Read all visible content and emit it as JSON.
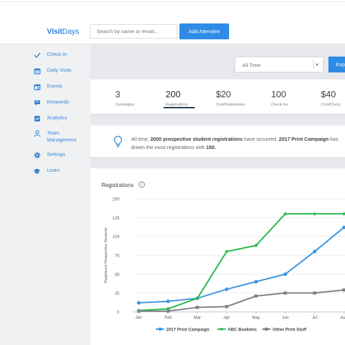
{
  "header": {
    "logo_visit": "Visit",
    "logo_days": "Days",
    "search_placeholder": "Search by name or email...",
    "add_button": "Add Attendee"
  },
  "sidebar": {
    "items": [
      {
        "label": "Check In",
        "icon": "check-icon"
      },
      {
        "label": "Daily Visits",
        "icon": "calendar-icon"
      },
      {
        "label": "Events",
        "icon": "calendar-event-icon"
      },
      {
        "label": "Keywords",
        "icon": "chat-icon"
      },
      {
        "label": "Analytics",
        "icon": "chart-icon"
      },
      {
        "label": "Team Management",
        "icon": "person-icon"
      },
      {
        "label": "Settings",
        "icon": "gear-icon"
      },
      {
        "label": "Learn",
        "icon": "graduation-cap-icon"
      }
    ]
  },
  "filters": {
    "time_range": "All Time",
    "export_label": "Exp"
  },
  "stats": [
    {
      "value": "3",
      "caption": "Campaigns"
    },
    {
      "value": "200",
      "caption": "Registrations"
    },
    {
      "value": "$20",
      "caption": "Cost/Registration"
    },
    {
      "value": "100",
      "caption": "Check Ins"
    },
    {
      "value": "$40",
      "caption": "Cost/Check"
    }
  ],
  "insight": {
    "p1": "All time, ",
    "b1": "2000 prospective student registrations",
    "p2": " have occurred. ",
    "b2": "2017 Print Campaign",
    "p3": " has driven the most registrations with ",
    "b3": "150."
  },
  "chart": {
    "title": "Registrations"
  },
  "chart_data": {
    "type": "line",
    "ylabel": "Registered Prospective Students",
    "xlabel": "",
    "ylim": [
      0,
      150
    ],
    "yticks": [
      0,
      25,
      50,
      75,
      100,
      125,
      150
    ],
    "categories": [
      "Jan",
      "Feb",
      "Mar",
      "Apr",
      "May",
      "Jun",
      "Jul",
      "Aug"
    ],
    "series": [
      {
        "name": "2017 Print Campaign",
        "color": "#3b95e0",
        "values": [
          12,
          14,
          18,
          30,
          40,
          50,
          80,
          112
        ]
      },
      {
        "name": "ABC Booklets",
        "color": "#27b84a",
        "values": [
          2,
          4,
          18,
          80,
          88,
          130,
          130,
          130
        ]
      },
      {
        "name": "Other Print Stuff",
        "color": "#7e8287",
        "values": [
          1,
          1,
          6,
          7,
          21,
          25,
          25,
          29
        ]
      }
    ],
    "legend_position": "bottom",
    "grid": true
  }
}
